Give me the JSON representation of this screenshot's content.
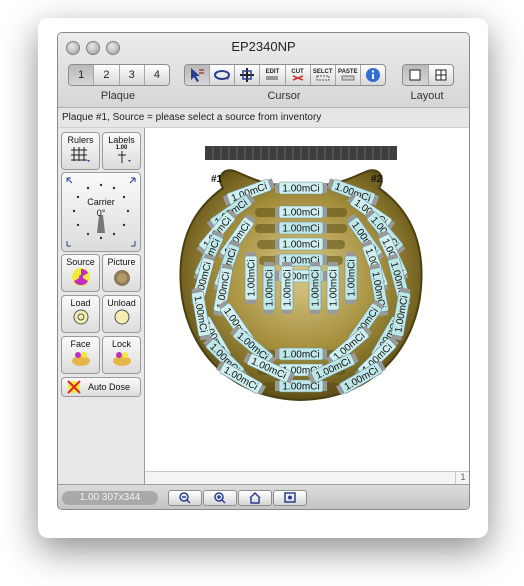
{
  "window": {
    "title": "EP2340NP"
  },
  "toolbar": {
    "plaque_label": "Plaque",
    "plaque_buttons": [
      "1",
      "2",
      "3",
      "4"
    ],
    "cursor_label": "Cursor",
    "cursor_tools": {
      "edit": "EDIT",
      "cut": "CUT",
      "select": "SELCT",
      "paste": "PASTE"
    },
    "layout_label": "Layout"
  },
  "status": {
    "text": "Plaque #1, Source = please select a source from inventory"
  },
  "sidebar": {
    "rulers": "Rulers",
    "labels": "Labels",
    "labels_value": "1.00",
    "carrier_label": "Carrier",
    "carrier_angle": "0°",
    "source": "Source",
    "picture": "Picture",
    "load": "Load",
    "unload": "Unload",
    "face": "Face",
    "lock": "Lock",
    "auto_dose": "Auto Dose"
  },
  "canvas": {
    "marker_1": "#1",
    "marker_2": "#2",
    "source_label": "1.00mCi"
  },
  "scroll": {
    "corner": "1"
  },
  "bottom": {
    "zoom_info": "1.00 307x344"
  }
}
